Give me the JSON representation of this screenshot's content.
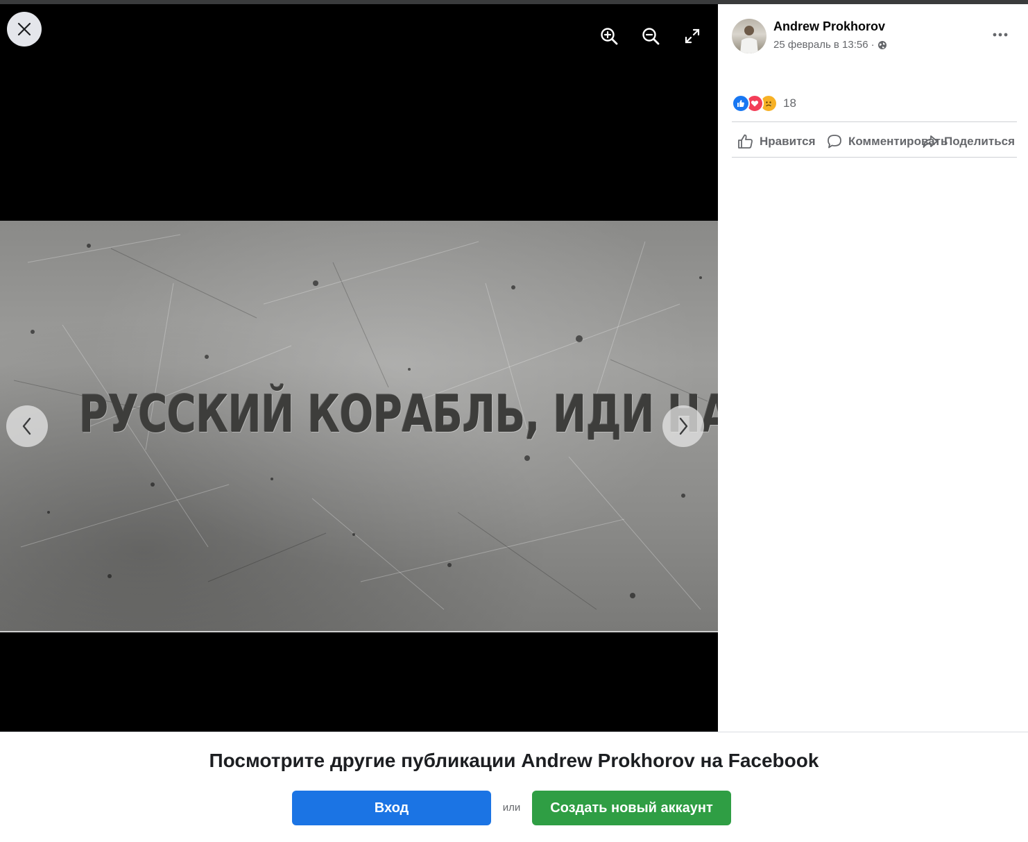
{
  "viewer": {
    "photo_text": "РУССКИЙ КОРАБЛЬ, ИДИ НАХУЙ!",
    "icons": {
      "close": "close-icon",
      "zoom_in": "zoom-in-icon",
      "zoom_out": "zoom-out-icon",
      "fullscreen": "fullscreen-icon",
      "prev": "chevron-left-icon",
      "next": "chevron-right-icon"
    }
  },
  "post": {
    "author": "Andrew Prokhorov",
    "timestamp": "25 февраль в 13:56",
    "separator": "·",
    "privacy_icon": "globe-icon",
    "reaction_count": "18",
    "reaction_types": [
      "like",
      "love",
      "sad"
    ],
    "actions": {
      "like": "Нравится",
      "comment": "Комментировать",
      "share": "Поделиться"
    }
  },
  "bottom": {
    "title": "Посмотрите другие публикации Andrew Prokhorov на Facebook",
    "login_label": "Вход",
    "or_label": "или",
    "create_label": "Создать новый аккаунт"
  },
  "colors": {
    "viewer_bg": "#000000",
    "login_button": "#1b74e4",
    "create_button": "#2f9e44",
    "secondary_text": "#65676b",
    "like_blue": "#1877f2",
    "love_red": "#f33e58",
    "sad_yellow": "#f7b125"
  }
}
